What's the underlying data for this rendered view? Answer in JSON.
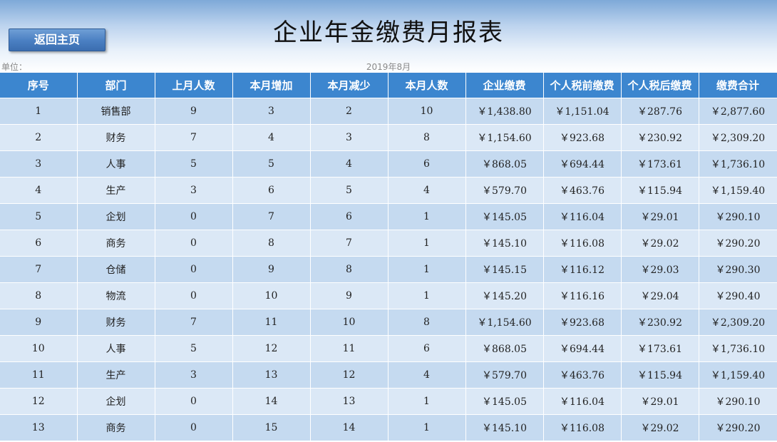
{
  "title": "企业年金缴费月报表",
  "back_button": "返回主页",
  "unit_label": "单位：",
  "date_label": "2019年8月",
  "colors": {
    "header_bg": "#3c86cf",
    "row_odd": "#c5daf0",
    "row_even": "#dbe8f6",
    "button": "#4a7fc2"
  },
  "columns": [
    "序号",
    "部门",
    "上月人数",
    "本月增加",
    "本月减少",
    "本月人数",
    "企业缴费",
    "个人税前缴费",
    "个人税后缴费",
    "缴费合计"
  ],
  "rows": [
    [
      "1",
      "销售部",
      "9",
      "3",
      "2",
      "10",
      "￥1,438.80",
      "￥1,151.04",
      "￥287.76",
      "￥2,877.60"
    ],
    [
      "2",
      "财务",
      "7",
      "4",
      "3",
      "8",
      "￥1,154.60",
      "￥923.68",
      "￥230.92",
      "￥2,309.20"
    ],
    [
      "3",
      "人事",
      "5",
      "5",
      "4",
      "6",
      "￥868.05",
      "￥694.44",
      "￥173.61",
      "￥1,736.10"
    ],
    [
      "4",
      "生产",
      "3",
      "6",
      "5",
      "4",
      "￥579.70",
      "￥463.76",
      "￥115.94",
      "￥1,159.40"
    ],
    [
      "5",
      "企划",
      "0",
      "7",
      "6",
      "1",
      "￥145.05",
      "￥116.04",
      "￥29.01",
      "￥290.10"
    ],
    [
      "6",
      "商务",
      "0",
      "8",
      "7",
      "1",
      "￥145.10",
      "￥116.08",
      "￥29.02",
      "￥290.20"
    ],
    [
      "7",
      "仓储",
      "0",
      "9",
      "8",
      "1",
      "￥145.15",
      "￥116.12",
      "￥29.03",
      "￥290.30"
    ],
    [
      "8",
      "物流",
      "0",
      "10",
      "9",
      "1",
      "￥145.20",
      "￥116.16",
      "￥29.04",
      "￥290.40"
    ],
    [
      "9",
      "财务",
      "7",
      "11",
      "10",
      "8",
      "￥1,154.60",
      "￥923.68",
      "￥230.92",
      "￥2,309.20"
    ],
    [
      "10",
      "人事",
      "5",
      "12",
      "11",
      "6",
      "￥868.05",
      "￥694.44",
      "￥173.61",
      "￥1,736.10"
    ],
    [
      "11",
      "生产",
      "3",
      "13",
      "12",
      "4",
      "￥579.70",
      "￥463.76",
      "￥115.94",
      "￥1,159.40"
    ],
    [
      "12",
      "企划",
      "0",
      "14",
      "13",
      "1",
      "￥145.05",
      "￥116.04",
      "￥29.01",
      "￥290.10"
    ],
    [
      "13",
      "商务",
      "0",
      "15",
      "14",
      "1",
      "￥145.10",
      "￥116.08",
      "￥29.02",
      "￥290.20"
    ]
  ]
}
